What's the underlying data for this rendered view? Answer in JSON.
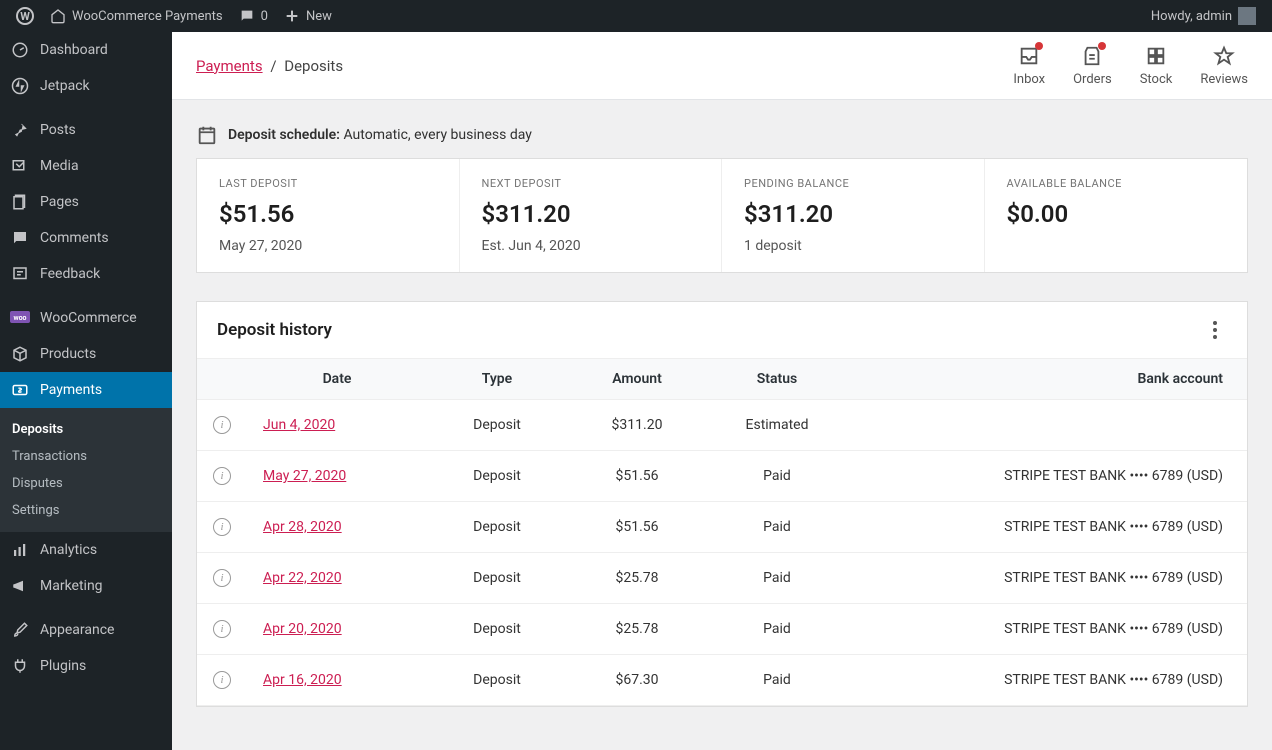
{
  "adminbar": {
    "site": "WooCommerce Payments",
    "comments": "0",
    "new": "New",
    "greeting": "Howdy, admin"
  },
  "sidebar": {
    "dashboard": "Dashboard",
    "jetpack": "Jetpack",
    "posts": "Posts",
    "media": "Media",
    "pages": "Pages",
    "comments": "Comments",
    "feedback": "Feedback",
    "woocommerce": "WooCommerce",
    "products": "Products",
    "payments": "Payments",
    "analytics": "Analytics",
    "marketing": "Marketing",
    "appearance": "Appearance",
    "plugins": "Plugins"
  },
  "submenu": {
    "deposits": "Deposits",
    "transactions": "Transactions",
    "disputes": "Disputes",
    "settings": "Settings"
  },
  "breadcrumb": {
    "parent": "Payments",
    "current": "Deposits",
    "sep": "/"
  },
  "topbarActions": {
    "inbox": "Inbox",
    "orders": "Orders",
    "stock": "Stock",
    "reviews": "Reviews"
  },
  "schedule": {
    "label": "Deposit schedule:",
    "value": "Automatic, every business day"
  },
  "summary": {
    "last": {
      "label": "LAST DEPOSIT",
      "value": "$51.56",
      "sub": "May 27, 2020"
    },
    "next": {
      "label": "NEXT DEPOSIT",
      "value": "$311.20",
      "sub": "Est. Jun 4, 2020"
    },
    "pending": {
      "label": "PENDING BALANCE",
      "value": "$311.20",
      "sub": "1 deposit"
    },
    "available": {
      "label": "AVAILABLE BALANCE",
      "value": "$0.00",
      "sub": ""
    }
  },
  "panel": {
    "title": "Deposit history"
  },
  "columns": {
    "date": "Date",
    "type": "Type",
    "amount": "Amount",
    "status": "Status",
    "bank": "Bank account"
  },
  "rows": [
    {
      "date": "Jun 4, 2020",
      "type": "Deposit",
      "amount": "$311.20",
      "status": "Estimated",
      "bank": ""
    },
    {
      "date": "May 27, 2020",
      "type": "Deposit",
      "amount": "$51.56",
      "status": "Paid",
      "bank": "STRIPE TEST BANK •••• 6789 (USD)"
    },
    {
      "date": "Apr 28, 2020",
      "type": "Deposit",
      "amount": "$51.56",
      "status": "Paid",
      "bank": "STRIPE TEST BANK •••• 6789 (USD)"
    },
    {
      "date": "Apr 22, 2020",
      "type": "Deposit",
      "amount": "$25.78",
      "status": "Paid",
      "bank": "STRIPE TEST BANK •••• 6789 (USD)"
    },
    {
      "date": "Apr 20, 2020",
      "type": "Deposit",
      "amount": "$25.78",
      "status": "Paid",
      "bank": "STRIPE TEST BANK •••• 6789 (USD)"
    },
    {
      "date": "Apr 16, 2020",
      "type": "Deposit",
      "amount": "$67.30",
      "status": "Paid",
      "bank": "STRIPE TEST BANK •••• 6789 (USD)"
    }
  ]
}
